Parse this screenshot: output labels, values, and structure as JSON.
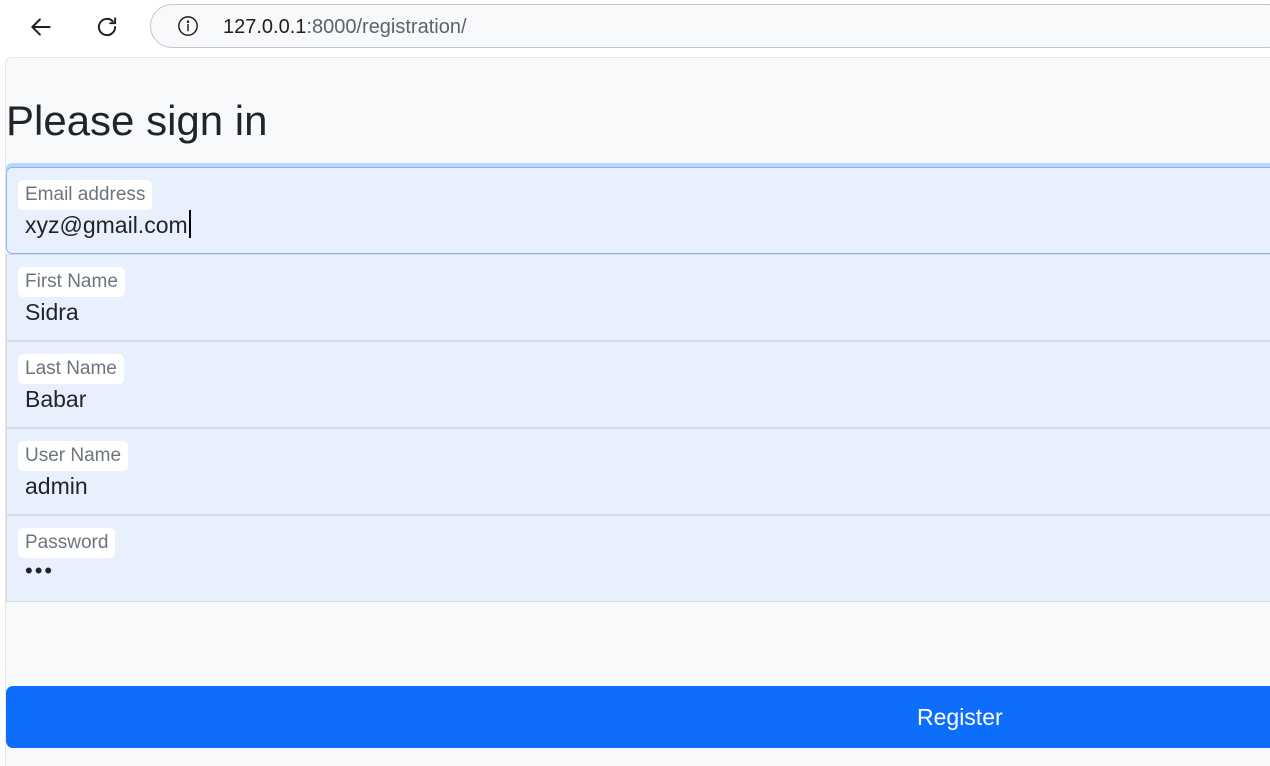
{
  "browser": {
    "url_host": "127.0.0.1",
    "url_rest": ":8000/registration/"
  },
  "form": {
    "title": "Please sign in",
    "fields": [
      {
        "label": "Email address",
        "value": "xyz@gmail.com"
      },
      {
        "label": "First Name",
        "value": "Sidra"
      },
      {
        "label": "Last Name",
        "value": "Babar"
      },
      {
        "label": "User Name",
        "value": "admin"
      },
      {
        "label": "Password",
        "value": "•••"
      }
    ],
    "submit_label": "Register"
  },
  "colors": {
    "primary": "#0d6efd",
    "field_background": "#e8f0fe",
    "focus_border": "#86b7fe",
    "page_background": "#f8f9fa"
  }
}
